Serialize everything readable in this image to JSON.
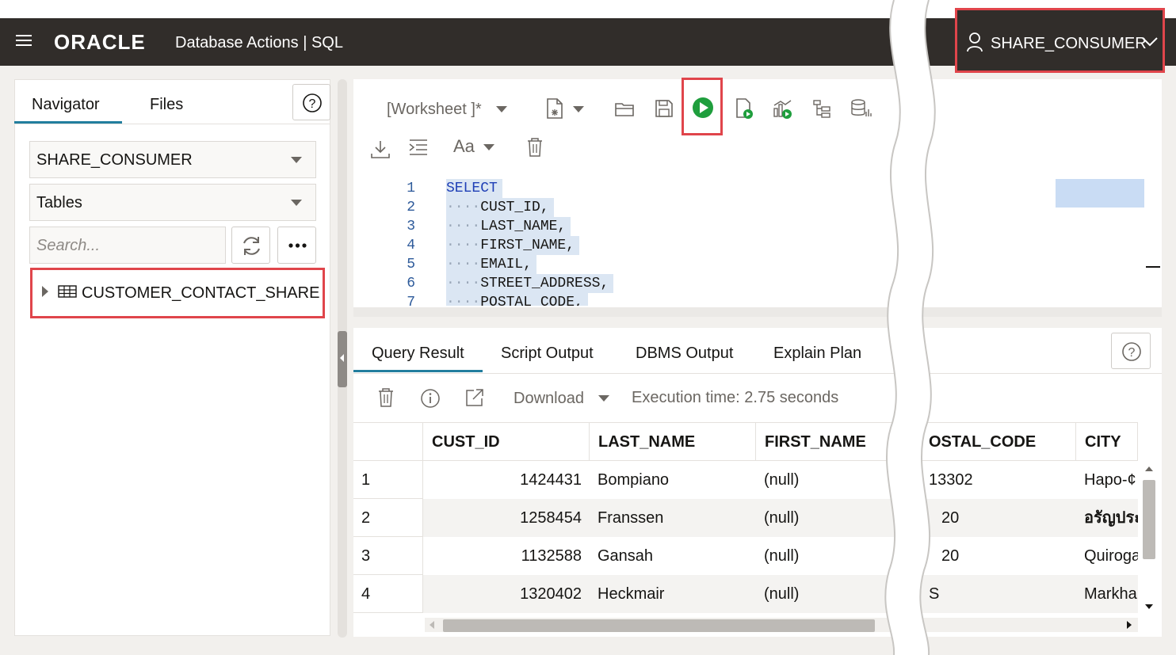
{
  "header": {
    "brand": "ORACLE",
    "app_title": "Database Actions |  SQL",
    "user": "SHARE_CONSUMER"
  },
  "navigator": {
    "tabs": [
      "Navigator",
      "Files"
    ],
    "schema_select": "SHARE_CONSUMER",
    "object_type_select": "Tables",
    "search_placeholder": "Search...",
    "tree_items": [
      "CUSTOMER_CONTACT_SHARE"
    ]
  },
  "editor": {
    "worksheet_label": "[Worksheet ]*",
    "font_label": "Aa",
    "lines": [
      {
        "n": "1",
        "text": "SELECT",
        "keyword": true
      },
      {
        "n": "2",
        "text": "CUST_ID,"
      },
      {
        "n": "3",
        "text": "LAST_NAME,"
      },
      {
        "n": "4",
        "text": "FIRST_NAME,"
      },
      {
        "n": "5",
        "text": "EMAIL,"
      },
      {
        "n": "6",
        "text": "STREET_ADDRESS,"
      },
      {
        "n": "7",
        "text": "POSTAL_CODE,"
      }
    ]
  },
  "results": {
    "tabs": [
      "Query Result",
      "Script Output",
      "DBMS Output",
      "Explain Plan"
    ],
    "download_label": "Download",
    "execution_time": "Execution time: 2.75 seconds",
    "columns": [
      "CUST_ID",
      "LAST_NAME",
      "FIRST_NAME",
      "OSTAL_CODE",
      "CITY"
    ],
    "rows": [
      {
        "num": "1",
        "cust_id": "1424431",
        "last_name": "Bompiano",
        "first_name": "(null)",
        "postal": "13302",
        "city": "Hapo-¢"
      },
      {
        "num": "2",
        "cust_id": "1258454",
        "last_name": "Franssen",
        "first_name": "(null)",
        "postal": "20",
        "city": "อรัญประ"
      },
      {
        "num": "3",
        "cust_id": "1132588",
        "last_name": "Gansah",
        "first_name": "(null)",
        "postal": "20",
        "city": "Quiroga"
      },
      {
        "num": "4",
        "cust_id": "1320402",
        "last_name": "Heckmair",
        "first_name": "(null)",
        "postal": "S",
        "city": "Markha"
      }
    ]
  },
  "colors": {
    "header_bg": "#312d2a",
    "accent_tab": "#227e9e",
    "highlight_box": "#e0454b",
    "run_green": "#1f9e3d"
  }
}
